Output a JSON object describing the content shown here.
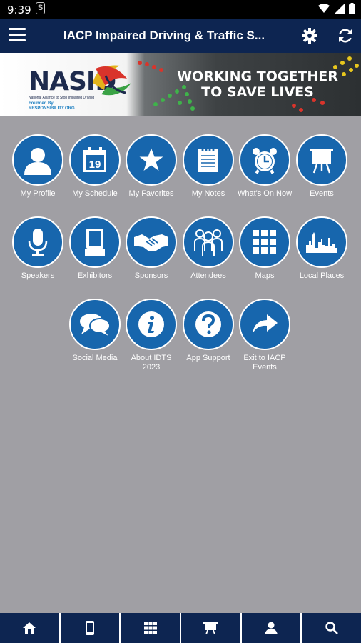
{
  "status_bar": {
    "time": "9:39",
    "sync_icon_letter": "S"
  },
  "app_bar": {
    "title": "IACP Impaired Driving & Traffic S...",
    "menu_icon": "hamburger-menu-icon",
    "settings_icon": "gear-icon",
    "refresh_icon": "refresh-icon"
  },
  "banner": {
    "logo_text": "NASID",
    "logo_subtitle": "National Alliance to Stop Impaired Driving",
    "funded_by": "Founded By",
    "sponsor": "RESPONSIBILITY.ORG",
    "tagline_line1": "WORKING TOGETHER",
    "tagline_line2": "TO SAVE LIVES"
  },
  "tiles": [
    {
      "label": "My Profile",
      "icon": "person-icon"
    },
    {
      "label": "My Schedule",
      "icon": "calendar-icon",
      "calendar_day": "19"
    },
    {
      "label": "My Favorites",
      "icon": "star-icon"
    },
    {
      "label": "My Notes",
      "icon": "notepad-icon"
    },
    {
      "label": "What's On Now",
      "icon": "alarm-clock-icon"
    },
    {
      "label": "Events",
      "icon": "easel-icon"
    },
    {
      "label": "Speakers",
      "icon": "microphone-icon"
    },
    {
      "label": "Exhibitors",
      "icon": "booth-icon"
    },
    {
      "label": "Sponsors",
      "icon": "handshake-icon"
    },
    {
      "label": "Attendees",
      "icon": "people-icon"
    },
    {
      "label": "Maps",
      "icon": "map-grid-icon"
    },
    {
      "label": "Local Places",
      "icon": "city-skyline-icon"
    },
    {
      "label": "Social Media",
      "icon": "chat-bubbles-icon"
    },
    {
      "label": "About IDTS 2023",
      "icon": "info-icon"
    },
    {
      "label": "App Support",
      "icon": "question-icon"
    },
    {
      "label": "Exit to IACP Events",
      "icon": "share-arrow-icon"
    }
  ],
  "bottom_nav": [
    {
      "icon": "home-icon"
    },
    {
      "icon": "phone-icon"
    },
    {
      "icon": "grid-icon"
    },
    {
      "icon": "easel-icon"
    },
    {
      "icon": "person-icon"
    },
    {
      "icon": "search-icon"
    }
  ],
  "colors": {
    "app_bar": "#0d2551",
    "background": "#a09fa4",
    "tile_circle": "#1766ad"
  }
}
